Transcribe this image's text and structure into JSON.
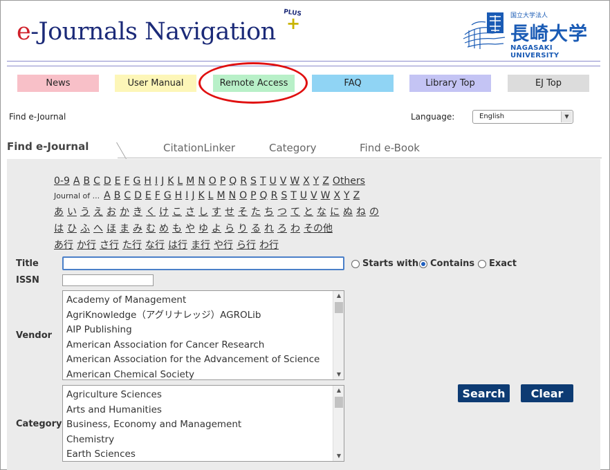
{
  "header": {
    "logo_e": "e",
    "logo_rest": "-Journals Navigation",
    "logo_plus_word": "PLUS",
    "logo_plus_sign": "+",
    "university_jp_small": "国立大学法人",
    "university_jp": "長崎大学",
    "university_en": "NAGASAKI UNIVERSITY"
  },
  "nav": [
    {
      "label": "News",
      "color": "#f8c0c8"
    },
    {
      "label": "User Manual",
      "color": "#fdf6b8"
    },
    {
      "label": "Remote Access",
      "color": "#b8f0c8"
    },
    {
      "label": "FAQ",
      "color": "#90d4f4"
    },
    {
      "label": "Library Top",
      "color": "#c4c4f4"
    },
    {
      "label": "EJ Top",
      "color": "#dcdcdc"
    }
  ],
  "find_label": "Find e-Journal",
  "language": {
    "label": "Language:",
    "value": "English"
  },
  "tabs": {
    "active": "Find e-Journal",
    "citation": "CitationLinker",
    "category": "Category",
    "ebook": "Find e-Book"
  },
  "alpha_rows": [
    {
      "prefix": "",
      "items": [
        "0-9",
        "A",
        "B",
        "C",
        "D",
        "E",
        "F",
        "G",
        "H",
        "I",
        "J",
        "K",
        "L",
        "M",
        "N",
        "O",
        "P",
        "Q",
        "R",
        "S",
        "T",
        "U",
        "V",
        "W",
        "X",
        "Y",
        "Z",
        "Others"
      ]
    },
    {
      "prefix": "Journal of ...",
      "items": [
        "A",
        "B",
        "C",
        "D",
        "E",
        "F",
        "G",
        "H",
        "I",
        "J",
        "K",
        "L",
        "M",
        "N",
        "O",
        "P",
        "Q",
        "R",
        "S",
        "T",
        "U",
        "V",
        "W",
        "X",
        "Y",
        "Z"
      ]
    },
    {
      "prefix": "",
      "items": [
        "あ",
        "い",
        "う",
        "え",
        "お",
        "か",
        "き",
        "く",
        "け",
        "こ",
        "さ",
        "し",
        "す",
        "せ",
        "そ",
        "た",
        "ち",
        "つ",
        "て",
        "と",
        "な",
        "に",
        "ぬ",
        "ね",
        "の"
      ]
    },
    {
      "prefix": "",
      "items": [
        "は",
        "ひ",
        "ふ",
        "へ",
        "ほ",
        "ま",
        "み",
        "む",
        "め",
        "も",
        "や",
        "ゆ",
        "よ",
        "ら",
        "り",
        "る",
        "れ",
        "ろ",
        "わ",
        "その他"
      ]
    },
    {
      "prefix": "",
      "items": [
        "あ行",
        "か行",
        "さ行",
        "た行",
        "な行",
        "は行",
        "ま行",
        "や行",
        "ら行",
        "わ行"
      ]
    }
  ],
  "form": {
    "title_label": "Title",
    "issn_label": "ISSN",
    "vendor_label": "Vendor",
    "category_label": "Category",
    "title_value": "",
    "issn_value": "",
    "match_options": [
      {
        "label": "Starts with",
        "selected": false
      },
      {
        "label": "Contains",
        "selected": true
      },
      {
        "label": "Exact",
        "selected": false
      }
    ],
    "vendors": [
      "Academy of Management",
      "AgriKnowledge（アグリナレッジ）AGROLib",
      "AIP Publishing",
      "American Association for Cancer Research",
      "American Association for the Advancement of Science",
      "American Chemical Society"
    ],
    "categories": [
      "Agriculture Sciences",
      "Arts and Humanities",
      "Business, Economy and Management",
      "Chemistry",
      "Earth Sciences"
    ],
    "search_label": "Search",
    "clear_label": "Clear"
  }
}
